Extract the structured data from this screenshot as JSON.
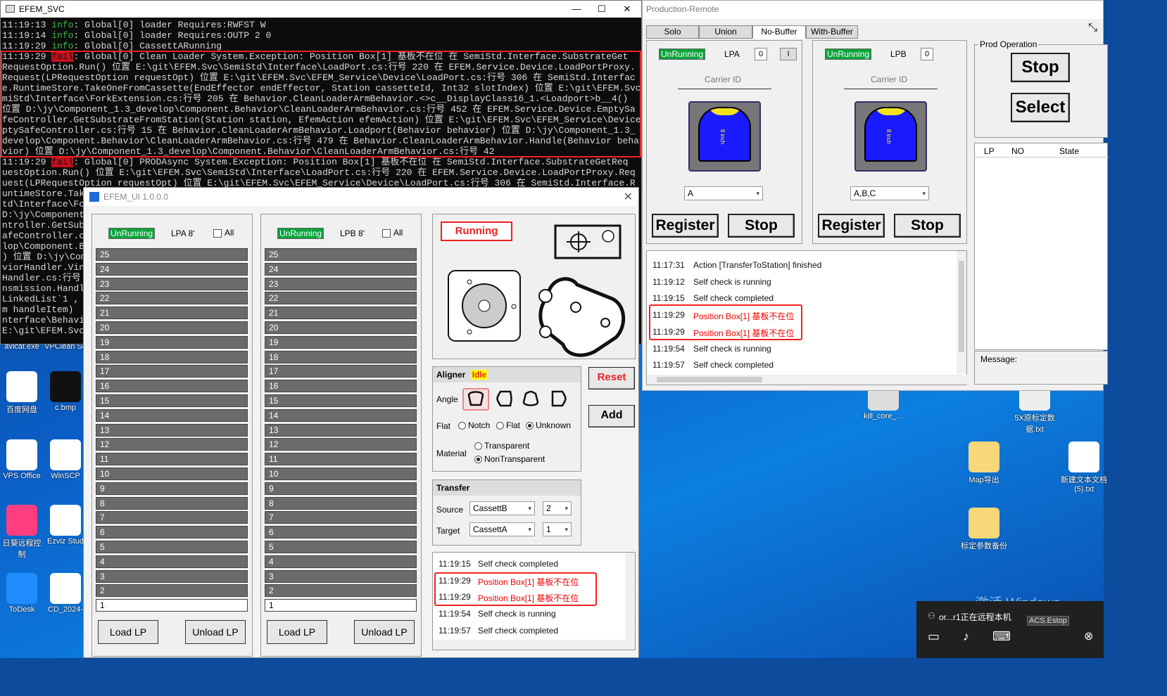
{
  "desktop": {
    "icons": [
      {
        "label": "avicat.exe",
        "name": "navicat"
      },
      {
        "label": "VPClean Se",
        "name": "vpclean"
      },
      {
        "label": "百度网盘",
        "name": "baidu-netdisk"
      },
      {
        "label": "c.bmp",
        "name": "bmp-file"
      },
      {
        "label": "VPS Office",
        "name": "wps-office"
      },
      {
        "label": "WinSCP",
        "name": "winscp"
      },
      {
        "label": "日葵远程控制",
        "name": "sunlogin"
      },
      {
        "label": "Ezviz Stud",
        "name": "ezviz"
      },
      {
        "label": "ToDesk",
        "name": "todesk"
      },
      {
        "label": "CD_2024-",
        "name": "cd-2024"
      },
      {
        "label": "kill_core_...",
        "name": "kill-core"
      },
      {
        "label": "5X原标定数据.txt",
        "name": "calib-txt"
      },
      {
        "label": "Map导出",
        "name": "map-export"
      },
      {
        "label": "新建文本文档(5).txt",
        "name": "new-text-doc"
      },
      {
        "label": "标定参数备份",
        "name": "calib-backup"
      }
    ],
    "watermark": "激活 Windows"
  },
  "console": {
    "title": "EFEM_SVC",
    "lines": [
      {
        "time": "11:19:13",
        "level": "info",
        "text": ": Global[0] loader Requires:RWFST  W"
      },
      {
        "time": "11:19:14",
        "level": "info",
        "text": ": Global[0] loader Requires:OUTP 2 0"
      },
      {
        "time": "11:19:29",
        "level": "info",
        "text": ": Global[0] CassettARunning"
      },
      {
        "time": "11:19:29",
        "level": "fail",
        "text": ": Global[0] Clean Loader System.Exception: Position Box[1]  基板不在位    在 SemiStd.Interface.SubstrateGet"
      },
      {
        "time": "",
        "level": "",
        "text": "RequestOption.Run() 位置 E:\\git\\EFEM.Svc\\SemiStd\\Interface\\LoadPort.cs:行号 220   在 EFEM.Service.Device.LoadPortProxy."
      },
      {
        "time": "",
        "level": "",
        "text": "Request(LPRequestOption requestOpt) 位置 E:\\git\\EFEM.Svc\\EFEM_Service\\Device\\LoadPort.cs:行号 306   在 SemiStd.Interfac"
      },
      {
        "time": "",
        "level": "",
        "text": "e.RuntimeStore.TakeOneFromCassette(EndEffector endEffector, Station cassetteId, Int32 slotIndex) 位置 E:\\git\\EFEM.Svc\\Se"
      },
      {
        "time": "",
        "level": "",
        "text": "miStd\\Interface\\ForkExtension.cs:行号 205    在 Behavior.CleanLoaderArmBehavior.<>c__DisplayClass16_1.<Loadport>b__4()"
      },
      {
        "time": "",
        "level": "",
        "text": "位置 D:\\jy\\Component_1.3_develop\\Component.Behavior\\CleanLoaderArmBehavior.cs:行号 452    在 EFEM.Service.Device.EmptySa"
      },
      {
        "time": "",
        "level": "",
        "text": "feController.GetSubstrateFromStation(Station station, EfemAction efemAction) 位置 E:\\git\\EFEM.Svc\\EFEM_Service\\Device\\Em"
      },
      {
        "time": "",
        "level": "",
        "text": "ptySafeController.cs:行号 15    在 Behavior.CleanLoaderArmBehavior.Loadport(Behavior behavior) 位置 D:\\jy\\Component_1.3_"
      },
      {
        "time": "",
        "level": "",
        "text": "develop\\Component.Behavior\\CleanLoaderArmBehavior.cs:行号 479    在 Behavior.CleanLoaderArmBehavior.Handle(Behavior beha"
      },
      {
        "time": "",
        "level": "",
        "text": "vior) 位置 D:\\jy\\Component_1.3_develop\\Component.Behavior\\CleanLoaderArmBehavior.cs:行号 42"
      },
      {
        "time": "11:19:29",
        "level": "fail",
        "text": ": Global[0] PRODAsync System.Exception: Position Box[1]  基板不在位    在 SemiStd.Interface.SubstrateGetReq"
      },
      {
        "time": "",
        "level": "",
        "text": "uestOption.Run() 位置 E:\\git\\EFEM.Svc\\SemiStd\\Interface\\LoadPort.cs:行号 220    在 EFEM.Service.Device.LoadPortProxy.Req"
      },
      {
        "time": "",
        "level": "",
        "text": "uest(LPRequestOption requestOpt) 位置 E:\\git\\EFEM.Svc\\EFEM_Service\\Device\\LoadPort.cs:行号 306    在 SemiStd.Interface.R"
      }
    ],
    "leftover": [
      "untimeStore.Take",
      "td\\Interface\\For",
      " D:\\jy\\Component",
      "ntroller.GetSubs",
      "afeController.cs",
      "lop\\Component.Be",
      ") 位置 D:\\jy\\Com",
      "viorHandler.Vin",
      "Handler.cs:行号",
      "nsmission.Handle",
      " LinkedList`1 ,",
      "m handleItem)",
      "nterface\\Behavi",
      "E:\\git\\EFEM.Svc\\"
    ]
  },
  "prod": {
    "title": "Production-Remote",
    "tabs": [
      "Solo",
      "Union",
      "No-Buffer",
      "With-Buffer"
    ],
    "lpa": {
      "status": "UnRunning",
      "name": "LPA",
      "count": "0",
      "flag": "I",
      "carrier_label": "Carrier ID",
      "combo": "A",
      "register": "Register",
      "stop": "Stop"
    },
    "lpb": {
      "status": "UnRunning",
      "name": "LPB",
      "count": "0",
      "carrier_label": "Carrier ID",
      "combo": "A,B,C",
      "register": "Register",
      "stop": "Stop"
    },
    "prod_op": {
      "label": "Prod Operation",
      "stop": "Stop",
      "select": "Select"
    },
    "table": {
      "cols": [
        "LP",
        "NO",
        "State"
      ]
    },
    "message_label": "Message:",
    "wafer_label": "8 inch",
    "log": [
      {
        "time": "11:17:31",
        "text": "Action [TransferToStation] finished",
        "err": false
      },
      {
        "time": "11:19:12",
        "text": "Self check is running",
        "err": false
      },
      {
        "time": "11:19:15",
        "text": "Self check completed",
        "err": false
      },
      {
        "time": "11:19:29",
        "text": "Position Box[1]  基板不在位",
        "err": true
      },
      {
        "time": "11:19:29",
        "text": "Position Box[1]  基板不在位",
        "err": true
      },
      {
        "time": "11:19:54",
        "text": "Self check is running",
        "err": false
      },
      {
        "time": "11:19:57",
        "text": "Self check completed",
        "err": false
      }
    ]
  },
  "efem": {
    "title": "EFEM_UI 1.0.0.0",
    "lpa": {
      "status": "UnRunning",
      "label": "LPA  8'",
      "all": "All"
    },
    "lpb": {
      "status": "UnRunning",
      "label": "LPB  8'",
      "all": "All"
    },
    "slots": [
      "25",
      "24",
      "23",
      "22",
      "21",
      "20",
      "19",
      "18",
      "17",
      "16",
      "15",
      "14",
      "13",
      "12",
      "11",
      "10",
      "9",
      "8",
      "7",
      "6",
      "5",
      "4",
      "3",
      "2"
    ],
    "last_slot": "1",
    "load": "Load LP",
    "unload": "Unload LP",
    "running": "Running",
    "aligner": {
      "label": "Aligner",
      "state": "Idle",
      "angle": "Angle",
      "flat": "Flat",
      "notch": "Notch",
      "flat_opt": "Flat",
      "unknown": "Unknown",
      "material": "Material",
      "transparent": "Transparent",
      "nontransparent": "NonTransparent"
    },
    "reset": "Reset",
    "add": "Add",
    "transfer": {
      "label": "Transfer",
      "source": "Source",
      "target": "Target",
      "source_val": "CassettB",
      "source_slot": "2",
      "target_val": "CassettA",
      "target_slot": "1"
    },
    "log": [
      {
        "time": "11:19:15",
        "text": "Self check completed",
        "err": false
      },
      {
        "time": "11:19:29",
        "text": "Position Box[1]  基板不在位",
        "err": true
      },
      {
        "time": "11:19:29",
        "text": "Position Box[1]  基板不在位",
        "err": true
      },
      {
        "time": "11:19:54",
        "text": "Self check is running",
        "err": false
      },
      {
        "time": "11:19:57",
        "text": "Self check completed",
        "err": false
      }
    ]
  },
  "notif": {
    "text": "or...r1正在远程本机",
    "tag": "ACS.Estop"
  }
}
